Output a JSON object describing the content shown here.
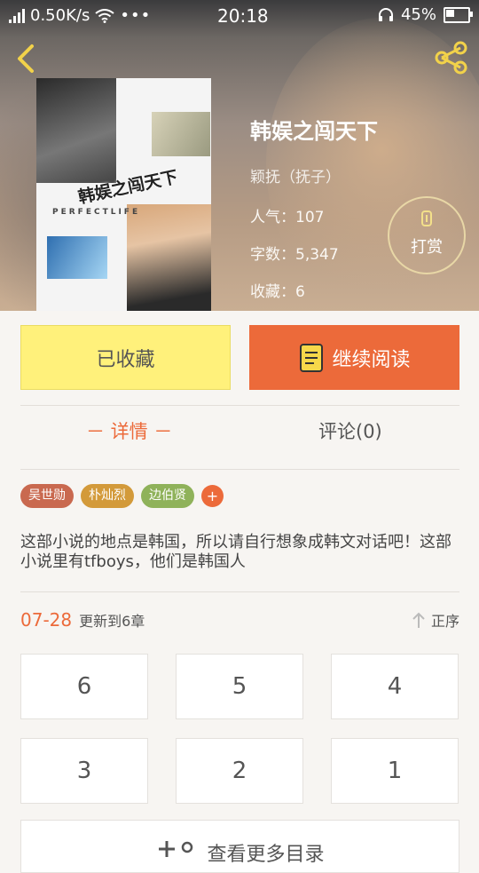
{
  "status_bar": {
    "speed": "0.50K/s",
    "time": "20:18",
    "battery": "45%",
    "battery_level": 0.45
  },
  "book": {
    "cover_title": "韩娱之闯天下",
    "cover_subtitle": "PERFECTLIFE",
    "title": "韩娱之闯天下",
    "author": "颖抚（抚子）",
    "popularity": "人气：107",
    "word_count": "字数：5,347",
    "favorites": "收藏：6"
  },
  "tip_button": {
    "label": "打赏"
  },
  "actions": {
    "favorite_label": "已收藏",
    "read_label": "继续阅读"
  },
  "tabs": {
    "detail": "－ 详情 －",
    "comments": "评论(0)"
  },
  "tags": [
    {
      "label": "吴世勋",
      "color": "#c9694f"
    },
    {
      "label": "朴灿烈",
      "color": "#d39a3a"
    },
    {
      "label": "边伯贤",
      "color": "#8fb25a"
    }
  ],
  "tag_add_label": "+",
  "description": "这部小说的地点是韩国，所以请自行想象成韩文对话吧！这部小说里有tfboys，他们是韩国人",
  "update": {
    "date": "07-28",
    "text": "更新到6章"
  },
  "sort_label": "正序",
  "chapters": [
    "6",
    "5",
    "4",
    "3",
    "2",
    "1"
  ],
  "more_label": "查看更多目录",
  "colors": {
    "accent": "#ec6a3a",
    "favorite_bg": "#fff17b"
  }
}
